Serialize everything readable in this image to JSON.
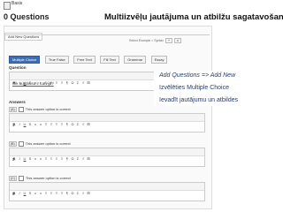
{
  "breadcrumb": "Basis",
  "header": {
    "title": "0 Questions",
    "subtitle": "...."
  },
  "slide_title": "Multiizvēļu jautājuma un atbilžu sagatavošana",
  "tabs": [
    {
      "label": "Add New Questions"
    }
  ],
  "question_tools": {
    "label": "Select Example > Syntax",
    "btn1": "+",
    "btn2": "x"
  },
  "question_types": [
    {
      "label": "Multiple Choice",
      "active": true
    },
    {
      "label": "True False",
      "active": false
    },
    {
      "label": "Free Text",
      "active": false
    },
    {
      "label": "Fill Text",
      "active": false
    },
    {
      "label": "Grammar",
      "active": false
    },
    {
      "label": "Essay",
      "active": false
    }
  ],
  "question": {
    "label": "Question",
    "content": "Cik autobusu ir Latvijā?"
  },
  "toolbar_buttons": [
    "B",
    "I",
    "U",
    "S",
    "x",
    "x",
    "≡",
    "≡",
    "≡",
    "≡",
    "¶",
    "Ω",
    "Σ",
    "√",
    "⊞"
  ],
  "answers": {
    "label": "Answers",
    "items": [
      {
        "num": "(A)",
        "correct_label": "This answer option is correct",
        "content": "1"
      },
      {
        "num": "(B)",
        "correct_label": "This answer option is correct",
        "content": "2"
      },
      {
        "num": "(C)",
        "correct_label": "This answer option is correct",
        "content": "5"
      }
    ]
  },
  "annotation": {
    "line1": "Add Questions => Add New",
    "line2": "Izvēlēties Multiple Choice",
    "line3": "Ievadīt jautājumu un atbildes"
  },
  "colors": {
    "accent": "#3d6db5",
    "annotation": "#2a3e6a"
  }
}
